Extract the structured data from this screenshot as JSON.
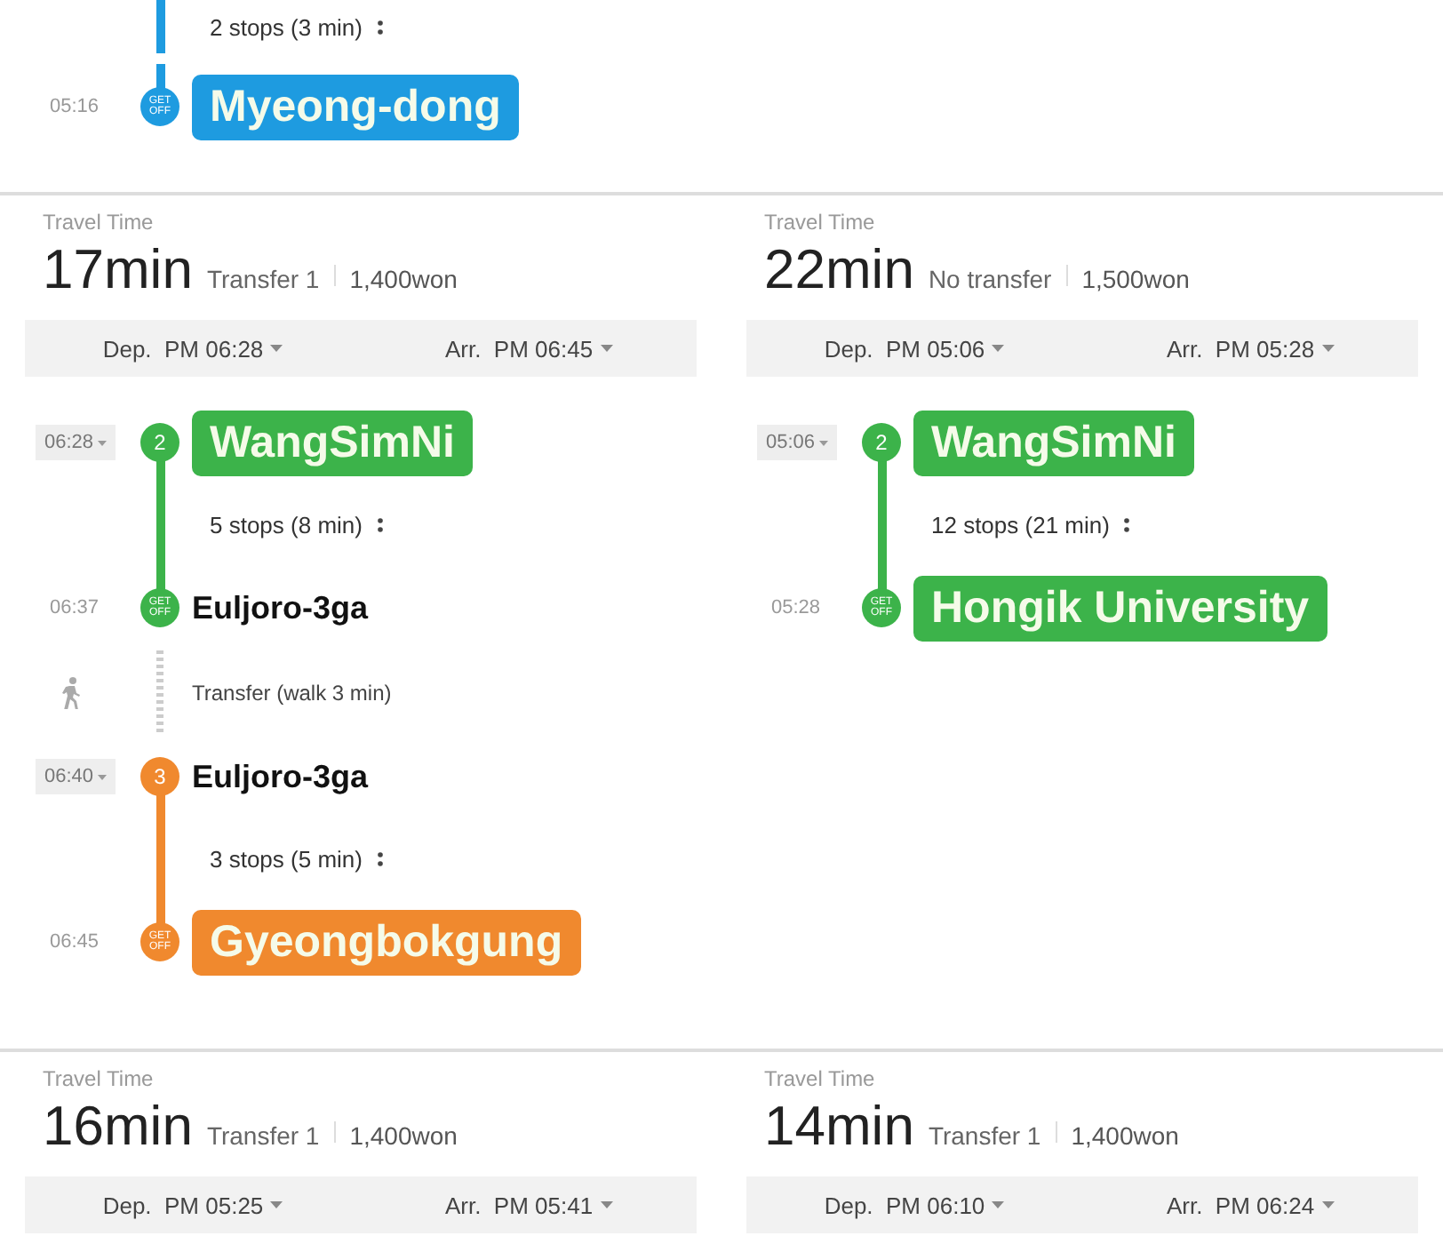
{
  "top_fragment": {
    "steps": [
      {
        "kind": "ride",
        "text": "2 stops (3 min)",
        "color": "#1e9be0"
      },
      {
        "kind": "alight",
        "time": "05:16",
        "badge": "GET OFF",
        "color": "#1e9be0",
        "name": "Myeong-dong",
        "highlighted": true
      }
    ]
  },
  "routes": [
    {
      "travel_label": "Travel Time",
      "duration": "17min",
      "transfer": "Transfer 1",
      "fare": "1,400won",
      "departure": "Dep.  PM 06:28",
      "arrival": "Arr.  PM 06:45",
      "steps": [
        {
          "kind": "board",
          "time": "06:28",
          "line": "2",
          "color": "#3cb34a",
          "name": "WangSimNi",
          "highlighted": true
        },
        {
          "kind": "ride",
          "text": "5 stops (8 min)",
          "color": "#3cb34a"
        },
        {
          "kind": "alight",
          "time": "06:37",
          "badge": "GET OFF",
          "color": "#3cb34a",
          "name": "Euljoro-3ga",
          "highlighted": false
        },
        {
          "kind": "walk",
          "text": "Transfer (walk 3 min)"
        },
        {
          "kind": "board",
          "time": "06:40",
          "line": "3",
          "color": "#f0892e",
          "name": "Euljoro-3ga",
          "highlighted": false
        },
        {
          "kind": "ride",
          "text": "3 stops (5 min)",
          "color": "#f0892e"
        },
        {
          "kind": "alight",
          "time": "06:45",
          "badge": "GET OFF",
          "color": "#f0892e",
          "name": "Gyeongbokgung",
          "highlighted": true
        }
      ]
    },
    {
      "travel_label": "Travel Time",
      "duration": "22min",
      "transfer": "No transfer",
      "fare": "1,500won",
      "departure": "Dep.  PM 05:06",
      "arrival": "Arr.  PM 05:28",
      "steps": [
        {
          "kind": "board",
          "time": "05:06",
          "line": "2",
          "color": "#3cb34a",
          "name": "WangSimNi",
          "highlighted": true
        },
        {
          "kind": "ride",
          "text": "12 stops (21 min)",
          "color": "#3cb34a"
        },
        {
          "kind": "alight",
          "time": "05:28",
          "badge": "GET OFF",
          "color": "#3cb34a",
          "name": "Hongik University",
          "highlighted": true
        }
      ]
    },
    {
      "travel_label": "Travel Time",
      "duration": "16min",
      "transfer": "Transfer 1",
      "fare": "1,400won",
      "departure": "Dep.  PM 05:25",
      "arrival": "Arr.  PM 05:41"
    },
    {
      "travel_label": "Travel Time",
      "duration": "14min",
      "transfer": "Transfer 1",
      "fare": "1,400won",
      "departure": "Dep.  PM 06:10",
      "arrival": "Arr.  PM 06:24"
    }
  ]
}
